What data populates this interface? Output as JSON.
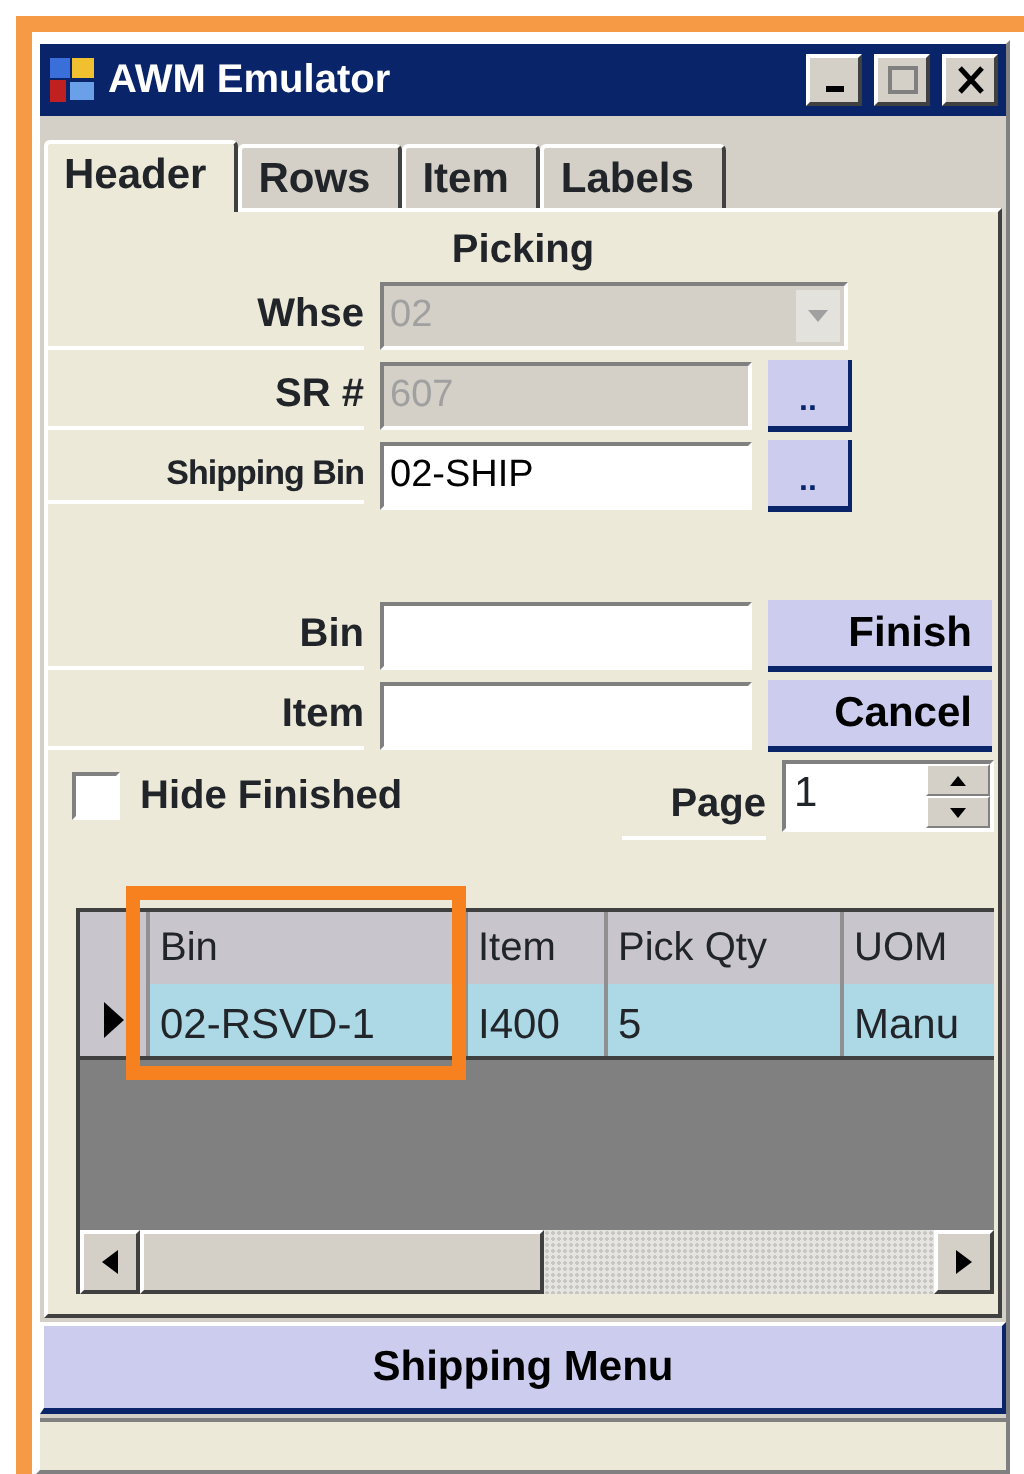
{
  "window": {
    "title": "AWM Emulator"
  },
  "tabs": [
    {
      "label": "Header",
      "selected": true
    },
    {
      "label": "Rows",
      "selected": false
    },
    {
      "label": "Item",
      "selected": false
    },
    {
      "label": "Labels",
      "selected": false
    }
  ],
  "section_title": "Picking",
  "fields": [
    {
      "label": "Whse",
      "kind": "combo",
      "value": "02",
      "disabled": true
    },
    {
      "label": "SR #",
      "kind": "lookup",
      "value": "607",
      "disabled": true,
      "button": ".."
    },
    {
      "label": "Shipping Bin",
      "kind": "lookup",
      "value": "02-SHIP",
      "disabled": false,
      "button": ".."
    }
  ],
  "scan_fields": [
    {
      "label": "Bin",
      "button": "Finish"
    },
    {
      "label": "Item",
      "button": "Cancel"
    }
  ],
  "hide_finished": {
    "label": "Hide Finished",
    "checked": false
  },
  "page": {
    "label": "Page",
    "value": "1"
  },
  "grid": {
    "columns": [
      "Bin",
      "Item",
      "Pick Qty",
      "UOM"
    ],
    "rows": [
      {
        "cells": [
          "02-RSVD-1",
          "I400",
          "5",
          "Manu"
        ],
        "selected": true,
        "current": true
      }
    ]
  },
  "shipping_menu_button": "Shipping Menu"
}
